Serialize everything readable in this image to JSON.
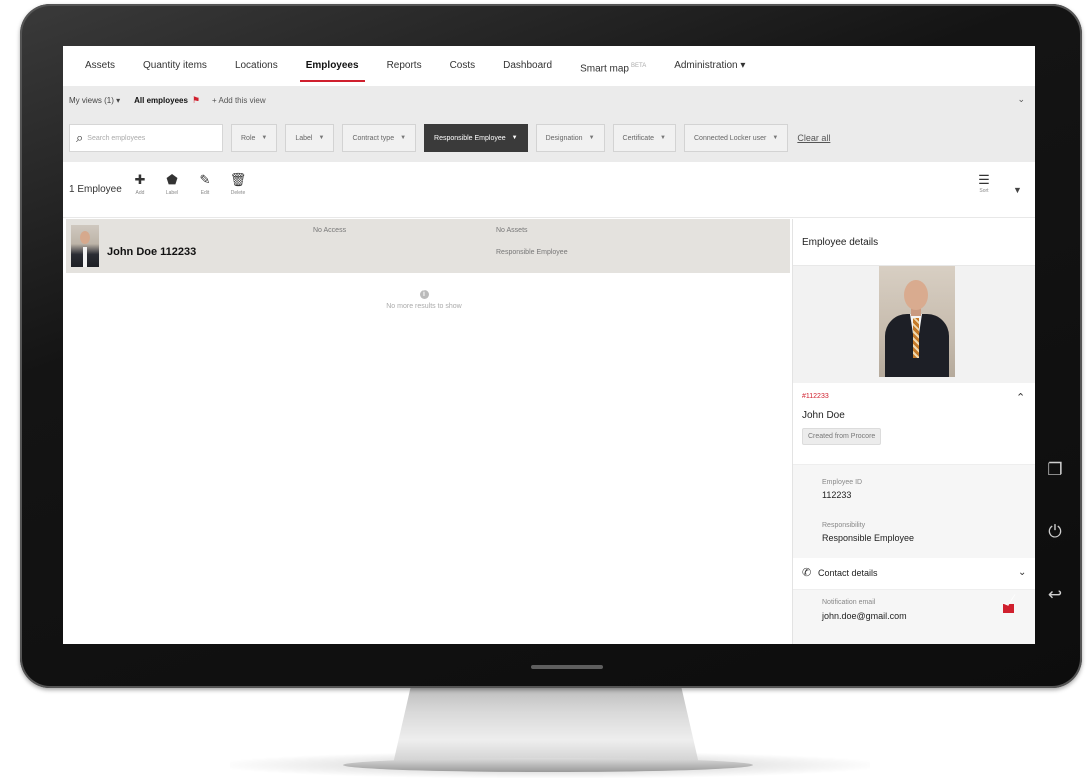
{
  "nav": {
    "tabs": [
      {
        "label": "Assets"
      },
      {
        "label": "Quantity items"
      },
      {
        "label": "Locations"
      },
      {
        "label": "Employees"
      },
      {
        "label": "Reports"
      },
      {
        "label": "Costs"
      },
      {
        "label": "Dashboard"
      },
      {
        "label": "Smart map",
        "badge": "BETA"
      },
      {
        "label": "Administration ▾"
      }
    ],
    "active_tab": "Employees"
  },
  "views": {
    "my_views": "My views (1) ▾",
    "current_view": "All employees",
    "add_view": "+ Add this view"
  },
  "filters": {
    "search_placeholder": "Search employees",
    "chips": [
      {
        "label": "Role"
      },
      {
        "label": "Label"
      },
      {
        "label": "Contract type"
      },
      {
        "label": "Responsible Employee",
        "active": true
      },
      {
        "label": "Designation"
      },
      {
        "label": "Certificate"
      },
      {
        "label": "Connected Locker user"
      }
    ],
    "clear_all": "Clear all"
  },
  "toolbar": {
    "count": "1 Employee",
    "actions": [
      {
        "label": "Add",
        "icon": "plus-icon"
      },
      {
        "label": "Label",
        "icon": "tag-icon"
      },
      {
        "label": "Edit",
        "icon": "pencil-icon"
      },
      {
        "label": "Delete",
        "icon": "trash-icon"
      }
    ],
    "sort": "Sort"
  },
  "list": {
    "rows": [
      {
        "name": "John Doe 112233",
        "access": "No Access",
        "assets": "No Assets",
        "responsibility": "Responsible Employee"
      }
    ],
    "no_more": "No more results to show"
  },
  "details": {
    "title": "Employee details",
    "employee_number": "#112233",
    "full_name": "John Doe",
    "created_tag": "Created from Procore",
    "employee_id_label": "Employee ID",
    "employee_id": "112233",
    "responsibility_label": "Responsibility",
    "responsibility": "Responsible Employee",
    "contact_title": "Contact details",
    "notification_email_label": "Notification email",
    "notification_email": "john.doe@gmail.com"
  },
  "colors": {
    "accent": "#d0202e",
    "active_filter": "#3a3a3a",
    "selected_row": "#e4e2de",
    "bezel": "#141414"
  }
}
